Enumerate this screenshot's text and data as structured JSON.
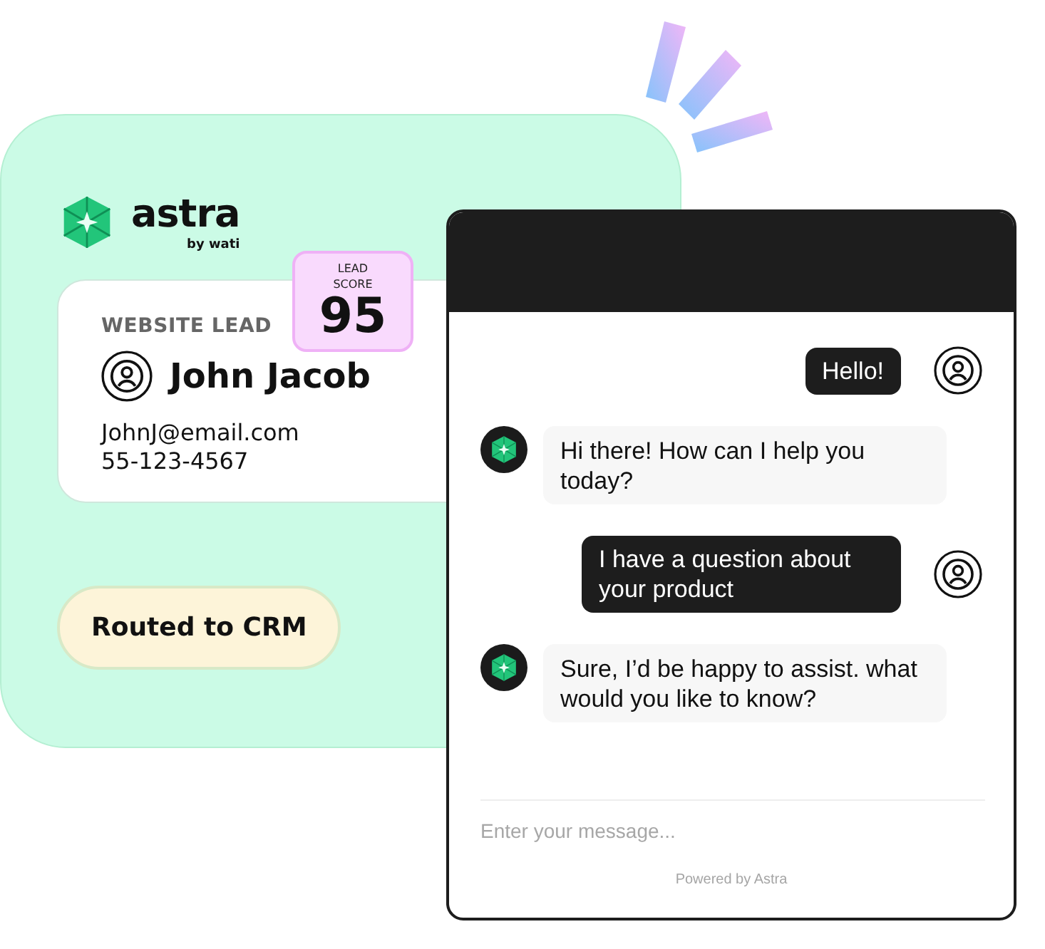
{
  "brand": {
    "name": "astra",
    "tagline": "by wati"
  },
  "lead": {
    "label": "WEBSITE LEAD",
    "name": "John Jacob",
    "email": "JohnJ@email.com",
    "phone": "55-123-4567",
    "score_label": "LEAD SCORE",
    "score": "95"
  },
  "status": "Routed to CRM",
  "chat": {
    "messages": [
      {
        "kind": "user",
        "text": "Hello!"
      },
      {
        "kind": "bot",
        "text": "Hi there! How can I help you today?"
      },
      {
        "kind": "user",
        "text": "I have a question about your product"
      },
      {
        "kind": "bot",
        "text": "Sure, I’d be happy to assist. what would you like to know?"
      }
    ],
    "input": {
      "placeholder": "Enter your message..."
    },
    "footer": "Powered by Astra"
  }
}
